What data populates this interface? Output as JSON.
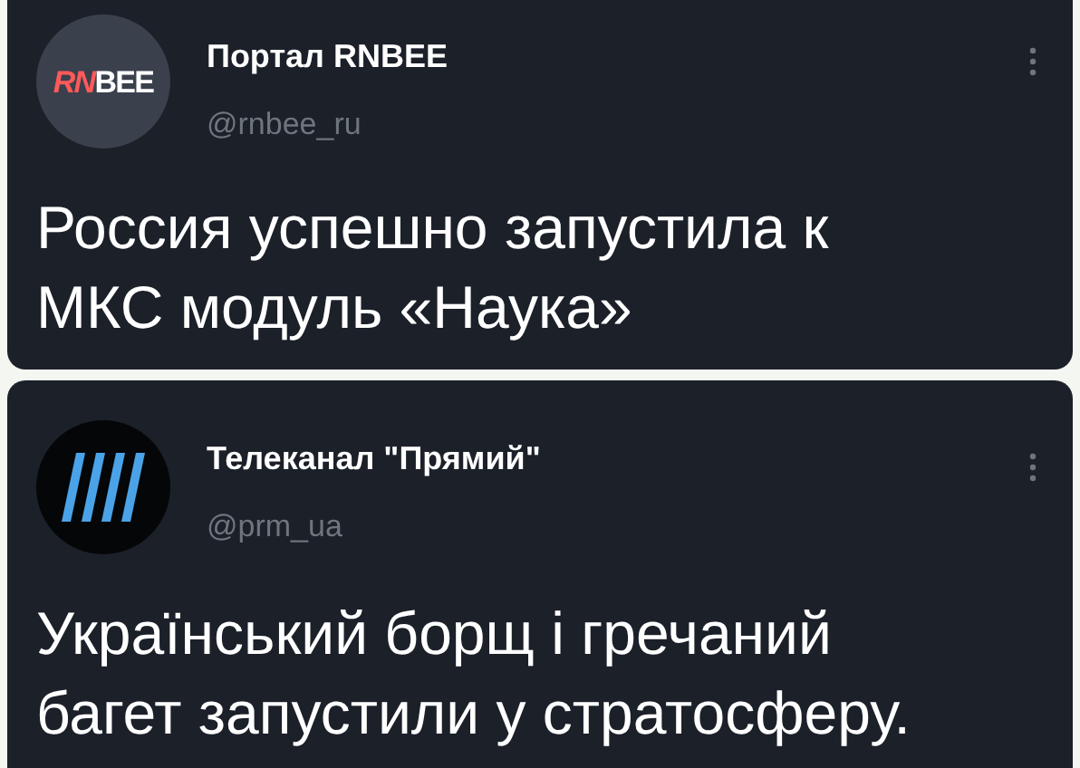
{
  "tweets": [
    {
      "author": "Портал RNBEE",
      "handle": "@rnbee_ru",
      "avatar": {
        "kind": "rnbee",
        "logo_parts": [
          {
            "text": "RN",
            "color": "#ff5a5a"
          },
          {
            "text": "BEE",
            "color": "#ffffff"
          }
        ]
      },
      "text": "Россия успешно запустила к МКС модуль «Наука»"
    },
    {
      "author": "Телеканал \"Прямий\"",
      "handle": "@prm_ua",
      "avatar": {
        "kind": "stripes"
      },
      "text": "Український борщ і гречаний багет запустили у стратосферу."
    }
  ]
}
